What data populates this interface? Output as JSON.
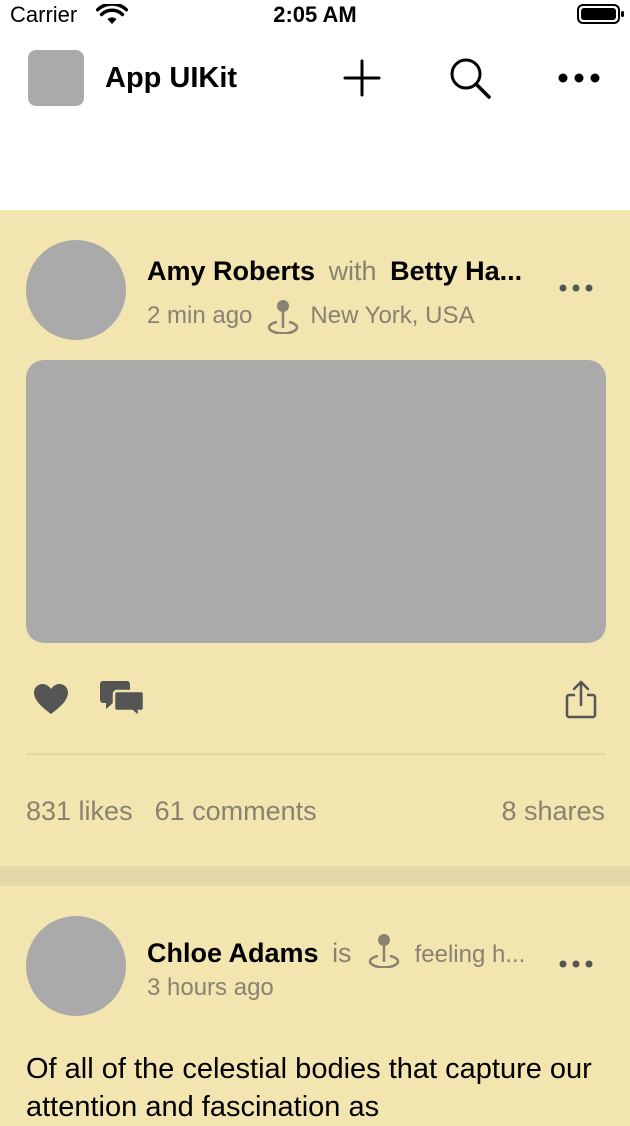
{
  "status_bar": {
    "carrier": "Carrier",
    "time": "2:05 AM"
  },
  "navbar": {
    "title": "App UIKit"
  },
  "posts": [
    {
      "author": "Amy Roberts",
      "connector": "with",
      "tagged": "Betty Ha...",
      "time": "2 min ago",
      "location": "New York, USA",
      "likes": "831 likes",
      "comments": "61 comments",
      "shares": "8 shares"
    },
    {
      "author": "Chloe Adams",
      "connector": "is",
      "feeling": "feeling h...",
      "time": "3 hours ago",
      "text": "Of all of the celestial bodies that capture our attention and fascination as"
    }
  ],
  "colors": {
    "feed_background": "#e3d9a8",
    "card_background": "#f3e5b0",
    "placeholder": "#aaaaaa",
    "secondary_text": "#8a8270",
    "icon_dark": "#555555"
  }
}
